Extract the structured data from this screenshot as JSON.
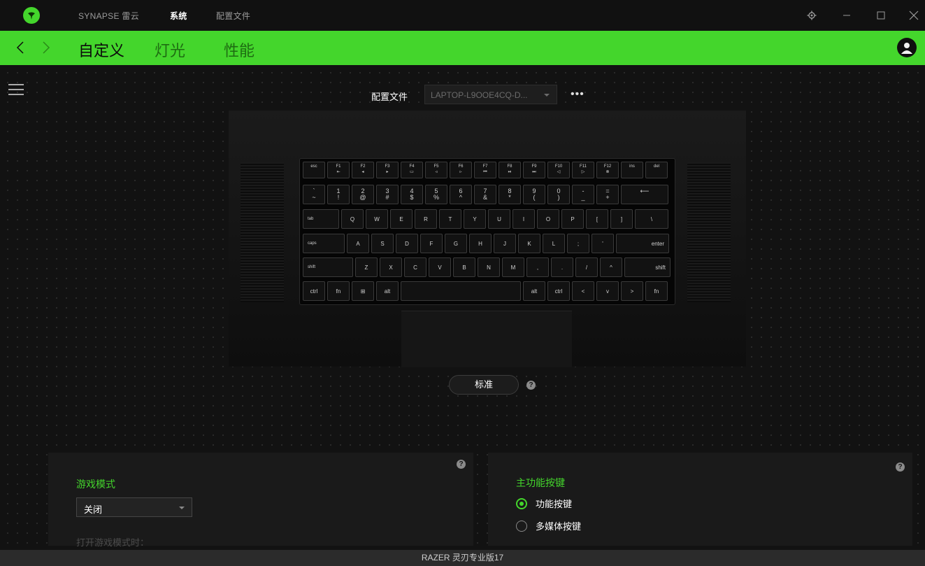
{
  "titlebar": {
    "tabs": [
      {
        "label": "SYNAPSE 雷云"
      },
      {
        "label": "系统"
      },
      {
        "label": "配置文件"
      }
    ]
  },
  "subnav": {
    "tabs": [
      {
        "label": "自定义"
      },
      {
        "label": "灯光"
      },
      {
        "label": "性能"
      }
    ]
  },
  "profile": {
    "label": "配置文件",
    "value": "LAPTOP-L9OOE4CQ-D...",
    "more": "•••"
  },
  "keyboard": {
    "fn_row": [
      {
        "t": "esc",
        "s": ""
      },
      {
        "t": "F1",
        "s": "⇤"
      },
      {
        "t": "F2",
        "s": "◂"
      },
      {
        "t": "F3",
        "s": "▸"
      },
      {
        "t": "F4",
        "s": "▭"
      },
      {
        "t": "F5",
        "s": "◃"
      },
      {
        "t": "F6",
        "s": "▹"
      },
      {
        "t": "F7",
        "s": "⏮"
      },
      {
        "t": "F8",
        "s": "⏯"
      },
      {
        "t": "F9",
        "s": "⏭"
      },
      {
        "t": "F10",
        "s": "◁"
      },
      {
        "t": "F11",
        "s": "▷"
      },
      {
        "t": "F12",
        "s": "⊗"
      },
      {
        "t": "ins",
        "s": ""
      },
      {
        "t": "del",
        "s": ""
      }
    ],
    "num_row": [
      {
        "t": "`",
        "s": "~"
      },
      {
        "t": "1",
        "s": "!"
      },
      {
        "t": "2",
        "s": "@"
      },
      {
        "t": "3",
        "s": "#"
      },
      {
        "t": "4",
        "s": "$"
      },
      {
        "t": "5",
        "s": "%"
      },
      {
        "t": "6",
        "s": "^"
      },
      {
        "t": "7",
        "s": "&"
      },
      {
        "t": "8",
        "s": "*"
      },
      {
        "t": "9",
        "s": "("
      },
      {
        "t": "0",
        "s": ")"
      },
      {
        "t": "-",
        "s": "_"
      },
      {
        "t": "=",
        "s": "+"
      },
      {
        "t": "⟵",
        "s": ""
      }
    ],
    "q_row": [
      "tab",
      "Q",
      "W",
      "E",
      "R",
      "T",
      "Y",
      "U",
      "I",
      "O",
      "P",
      "[",
      "]",
      "\\"
    ],
    "a_row": [
      "caps",
      "A",
      "S",
      "D",
      "F",
      "G",
      "H",
      "J",
      "K",
      "L",
      ";",
      "'",
      "enter"
    ],
    "z_row": [
      "shift",
      "Z",
      "X",
      "C",
      "V",
      "B",
      "N",
      "M",
      ",",
      ".",
      "/",
      "^",
      "shift"
    ],
    "bottom_row": [
      "ctrl",
      "fn",
      "⊞",
      "alt",
      "",
      "alt",
      "ctrl",
      "<",
      "v",
      ">",
      "fn"
    ]
  },
  "mode_button": "标准",
  "help_glyph": "?",
  "game_mode": {
    "title": "游戏模式",
    "dropdown_value": "关闭",
    "faded_text": "打开游戏模式时："
  },
  "function_keys": {
    "title": "主功能按键",
    "options": [
      {
        "label": "功能按键",
        "selected": true
      },
      {
        "label": "多媒体按键",
        "selected": false
      }
    ]
  },
  "footer": {
    "device": "RAZER 灵刃专业版17"
  },
  "colors": {
    "accent": "#44d62c",
    "background": "#111111",
    "panel": "#1a1a1a"
  }
}
